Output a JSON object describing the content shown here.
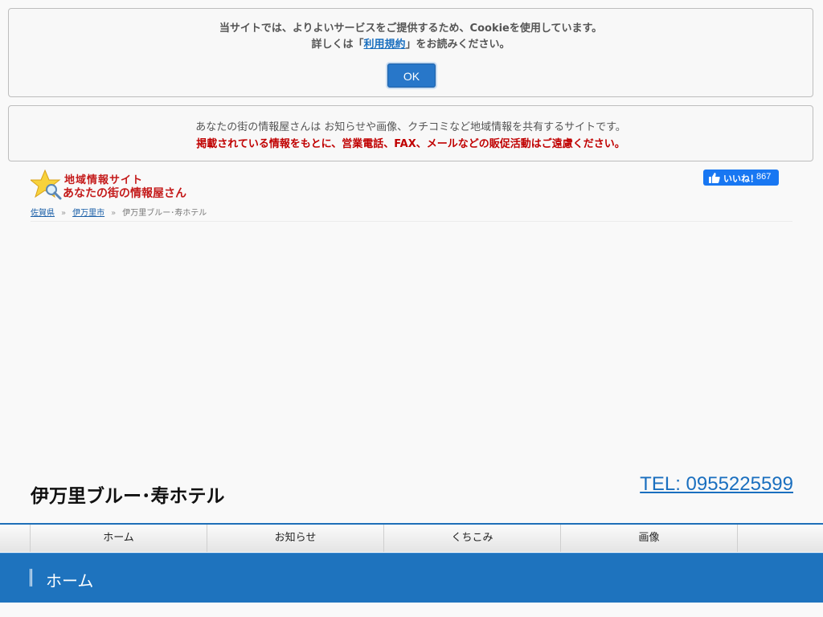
{
  "cookie_notice": {
    "line1": "当サイトでは、よりよいサービスをご提供するため、Cookieを使用しています。",
    "line2_prefix": "詳しくは「",
    "link": "利用規約",
    "line2_suffix": "」をお読みください。",
    "ok_button": "OK"
  },
  "intro": {
    "line1": "あなたの街の情報屋さんは お知らせや画像、クチコミなど地域情報を共有するサイトです。",
    "warning": "掲載されている情報をもとに、営業電話、FAX、メールなどの販促活動はご遠慮ください。"
  },
  "logo": {
    "line1": "地域情報サイト",
    "line2": "あなたの街の情報屋さん",
    "icon": "star-magnifier-icon"
  },
  "facebook": {
    "like_label": "いいね！",
    "count": "867",
    "color": "#1877f2"
  },
  "breadcrumb": {
    "items": [
      "佐賀県",
      "伊万里市"
    ],
    "separator": "»",
    "current": "伊万里ブルー･寿ホテル"
  },
  "shop": {
    "name": "伊万里ブルー･寿ホテル",
    "tel": "TEL: 0955225599"
  },
  "nav": {
    "items": [
      "ホーム",
      "お知らせ",
      "くちこみ",
      "画像"
    ]
  },
  "section": {
    "title": "ホーム",
    "color": "#1e73be"
  }
}
